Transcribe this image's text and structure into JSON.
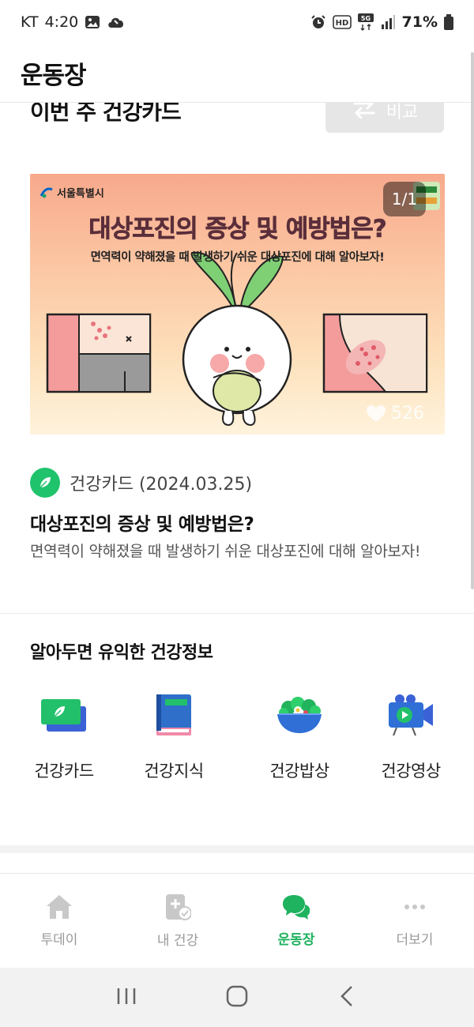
{
  "status_bar": {
    "carrier": "KT",
    "time": "4:20",
    "battery": "71%",
    "hd_label": "HD",
    "network": "5G"
  },
  "header": {
    "title": "운동장"
  },
  "section": {
    "title": "이번 주 건강카드",
    "compare_label": "비교"
  },
  "card": {
    "image": {
      "org_label": "서울특별시",
      "headline": "대상포진의 증상 및 예방법은?",
      "subline": "면역력이 약해졌을 때 발생하기 쉬운 대상포진에 대해 알아보자!",
      "page_indicator": "1/1",
      "likes": "526"
    },
    "source": "건강카드 (2024.03.25)",
    "title": "대상포진의 증상 및 예방법은?",
    "description": "면역력이 약해졌을 때 발생하기 쉬운 대상포진에 대해 알아보자!"
  },
  "info_section": {
    "title": "알아두면 유익한 건강정보",
    "items": [
      {
        "label": "건강카드",
        "icon": "health-card-icon"
      },
      {
        "label": "건강지식",
        "icon": "health-book-icon"
      },
      {
        "label": "건강밥상",
        "icon": "salad-bowl-icon"
      },
      {
        "label": "건강영상",
        "icon": "video-camera-icon"
      }
    ]
  },
  "bottom_nav": {
    "items": [
      {
        "label": "투데이",
        "icon": "home-icon",
        "active": false
      },
      {
        "label": "내 건강",
        "icon": "health-record-icon",
        "active": false
      },
      {
        "label": "운동장",
        "icon": "chat-bubbles-icon",
        "active": true
      },
      {
        "label": "더보기",
        "icon": "more-dots-icon",
        "active": false
      }
    ]
  },
  "colors": {
    "accent": "#1fb25f",
    "inactive": "#999999",
    "card_headline": "#5a2e3a"
  }
}
